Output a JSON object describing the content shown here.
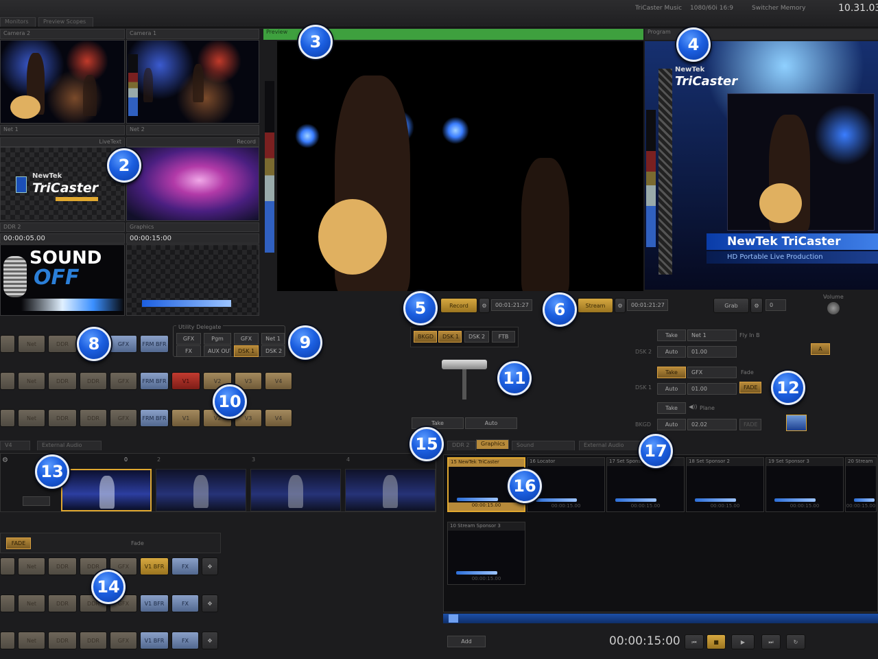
{
  "app": {
    "clock": "10.31.03",
    "music": "TriCaster Music",
    "format": "1080/60i 16:9",
    "switcher_memory": "Switcher Memory"
  },
  "tabs": [
    "Monitors",
    "Preview Scopes"
  ],
  "monitors": {
    "cam2": "Camera 2",
    "cam1": "Camera 1",
    "net1": "Net 1",
    "net2": "Net 2",
    "livetext": "LiveText",
    "record": "Record",
    "ddr2": "DDR 2",
    "graphics": "Graphics",
    "ddr_time": "00:00:05.00",
    "gfx_time": "00:00:15:00",
    "sound_logo_1": "SOUND",
    "sound_logo_2": "OFF",
    "newtek": "NewTek",
    "tricaster": "TriCaster"
  },
  "preview": {
    "label": "Preview"
  },
  "program": {
    "label": "Program",
    "lower_third_title": "NewTek TriCaster",
    "lower_third_sub": "HD Portable Live Production",
    "newtek": "NewTek",
    "tricaster": "TriCaster"
  },
  "controls": {
    "record": "Record",
    "record_time": "00:01:21:27",
    "stream": "Stream",
    "stream_time": "00:01:21:27",
    "grab": "Grab",
    "grab_count": "0",
    "volume": "Volume"
  },
  "delegate": {
    "title": "Utility Delegate",
    "row1": [
      "GFX",
      "Pgm",
      "GFX",
      "Net 1"
    ],
    "row2": [
      "FX",
      "AUX OUT",
      "DSK 1",
      "DSK 2"
    ]
  },
  "switcher": {
    "row1": [
      "Net",
      "DDR",
      "GFX",
      "FRM BFR"
    ],
    "row2": [
      "Net",
      "DDR",
      "DDR",
      "GFX",
      "FRM BFR",
      "V1",
      "V2",
      "V3",
      "V4"
    ],
    "row3": [
      "Net",
      "DDR",
      "DDR",
      "GFX",
      "FRM BFR",
      "V1",
      "V2",
      "V3",
      "V4"
    ]
  },
  "transition": {
    "bkgd": "BKGD",
    "dsk1": "DSK 1",
    "dsk2": "DSK 2",
    "ftb": "FTB",
    "take": "Take",
    "auto": "Auto"
  },
  "dsk": {
    "dsk2": {
      "label": "DSK 2",
      "take": "Take",
      "auto": "Auto",
      "source": "Net 1",
      "time": "01.00",
      "effect": "Fly In B"
    },
    "dsk1": {
      "label": "DSK 1",
      "take": "Take",
      "auto": "Auto",
      "source": "GFX",
      "time": "01.00",
      "effect": "Fade",
      "fade": "FADE"
    },
    "bkgd": {
      "label": "BKGD",
      "take": "Take",
      "auto": "Auto",
      "source": "Plane",
      "time": "02.02",
      "fade": "FADE"
    }
  },
  "bottom_tabs": {
    "v4": "V4",
    "external_audio": "External Audio",
    "ddr2": "DDR 2",
    "graphics": "Graphics",
    "sound": "Sound",
    "ext_audio": "External Audio"
  },
  "memory_strip": {
    "labels": [
      "0",
      "2",
      "3",
      "4"
    ]
  },
  "overlay": {
    "fade": "FADE",
    "fade_label": "Fade"
  },
  "overlay_rows": [
    [
      "Net",
      "DDR",
      "DDR",
      "GFX",
      "V1 BFR",
      "FX"
    ],
    [
      "Net",
      "DDR",
      "DDR",
      "GFX",
      "V1 BFR",
      "FX"
    ],
    [
      "Net",
      "DDR",
      "DDR",
      "GFX",
      "V1 BFR",
      "FX"
    ]
  ],
  "playlist": {
    "items": [
      {
        "title": "15 NewTek TriCaster",
        "time": "00:00:15.00"
      },
      {
        "title": "16 Locator",
        "time": "00:00:15.00"
      },
      {
        "title": "17 Set Sponsor 1",
        "time": "00:00:15.00"
      },
      {
        "title": "18 Set Sponsor 2",
        "time": "00:00:15.00"
      },
      {
        "title": "19 Set Sponsor 3",
        "time": "00:00:15.00"
      },
      {
        "title": "20 Stream",
        "time": "00:00:15.00"
      },
      {
        "title": "10 Stream Sponsor 3",
        "time": "00:00:15.00"
      }
    ],
    "add": "Add",
    "timecode": "00:00:15:00"
  },
  "badges": [
    "2",
    "3",
    "4",
    "5",
    "6",
    "8",
    "9",
    "10",
    "11",
    "12",
    "13",
    "14",
    "15",
    "16",
    "17"
  ],
  "colors": {
    "accent_orange": "#e0a830",
    "badge_blue": "#1c5fe0",
    "preview_green": "#3ea03e",
    "program_red": "#a02020"
  }
}
